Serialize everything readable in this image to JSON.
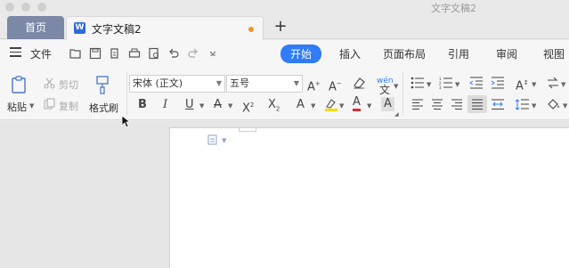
{
  "window": {
    "title": "文字文稿2"
  },
  "tabs": {
    "home_label": "首页",
    "doc_label": "文字文稿2",
    "add_label": "+"
  },
  "menu": {
    "file_label": "文件",
    "ribbon_tabs": [
      "开始",
      "插入",
      "页面布局",
      "引用",
      "审阅",
      "视图"
    ],
    "active_tab": "开始"
  },
  "ribbon": {
    "paste_label": "粘贴",
    "cut_label": "剪切",
    "copy_label": "复制",
    "format_painter_label": "格式刷",
    "font_name": "宋体 (正文)",
    "font_size": "五号",
    "phonetic_label": "wén"
  },
  "colors": {
    "accent": "#2f7cf6",
    "home_tab": "#7b88a6",
    "unsaved_dot": "#f0932b",
    "highlight": "#f5d90a",
    "font_color": "#d03030"
  }
}
